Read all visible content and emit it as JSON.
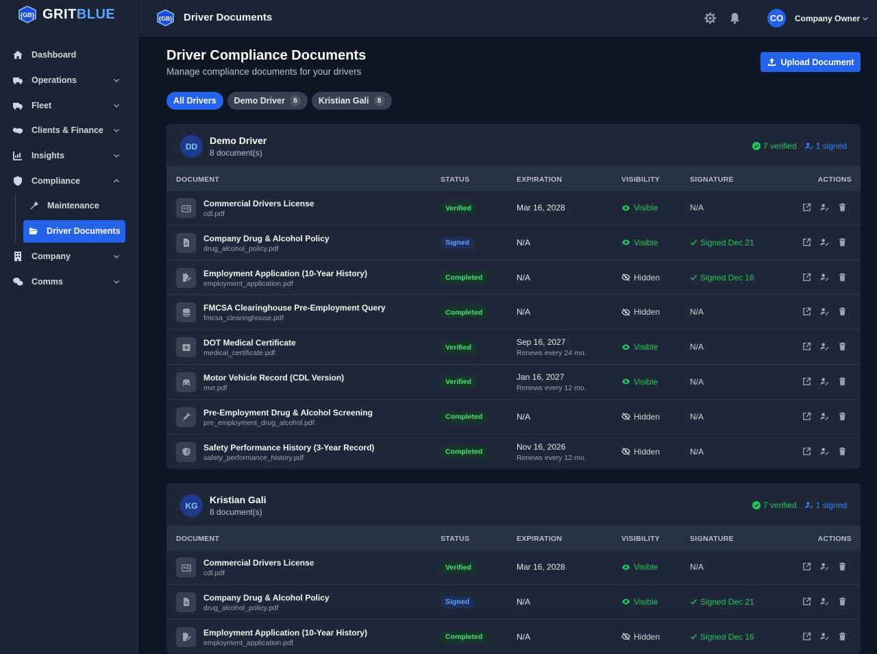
{
  "brand": {
    "name_part1": "GRIT",
    "name_part2": "BLUE",
    "badge": "{GB}"
  },
  "sidebar": {
    "items": [
      {
        "label": "Dashboard",
        "icon": "home-icon"
      },
      {
        "label": "Operations",
        "icon": "truck-icon"
      },
      {
        "label": "Fleet",
        "icon": "truck-icon"
      },
      {
        "label": "Clients & Finance",
        "icon": "handshake-icon"
      },
      {
        "label": "Insights",
        "icon": "chart-icon"
      },
      {
        "label": "Compliance",
        "icon": "shield-icon"
      }
    ],
    "compliance_sub": [
      {
        "label": "Maintenance",
        "icon": "wrench-icon"
      },
      {
        "label": "Driver Documents",
        "icon": "folder-open-icon",
        "active": true
      }
    ],
    "items_after": [
      {
        "label": "Company",
        "icon": "building-icon"
      },
      {
        "label": "Comms",
        "icon": "chat-icon"
      }
    ]
  },
  "topbar": {
    "title": "Driver Documents",
    "user_initials": "CO",
    "user_name": "Company Owner"
  },
  "page": {
    "title": "Driver Compliance Documents",
    "subtitle": "Manage compliance documents for your drivers",
    "upload_label": "Upload Document"
  },
  "filters": [
    {
      "label": "All Drivers",
      "active": true
    },
    {
      "label": "Demo Driver",
      "count": "8"
    },
    {
      "label": "Kristian Gali",
      "count": "8"
    }
  ],
  "table_headers": {
    "document": "DOCUMENT",
    "status": "STATUS",
    "expiration": "EXPIRATION",
    "visibility": "VISIBILITY",
    "signature": "SIGNATURE",
    "actions": "ACTIONS"
  },
  "drivers": [
    {
      "initials": "DD",
      "name": "Demo Driver",
      "count_text": "8 document(s)",
      "verified": "7 verified",
      "signed": "1 signed",
      "docs": [
        {
          "name": "Commercial Drivers License",
          "file": "cdl.pdf",
          "icon": "id-card-icon",
          "status": "Verified",
          "status_color": "green",
          "exp": "Mar 16, 2028",
          "exp_sub": "",
          "visibility": "Visible",
          "signature": "N/A"
        },
        {
          "name": "Company Drug & Alcohol Policy",
          "file": "drug_alcohol_policy.pdf",
          "icon": "file-icon",
          "status": "Signed",
          "status_color": "blue",
          "exp": "N/A",
          "exp_sub": "",
          "visibility": "Visible",
          "signature": "Signed Dec 21"
        },
        {
          "name": "Employment Application (10-Year History)",
          "file": "employment_application.pdf",
          "icon": "file-signature-icon",
          "status": "Completed",
          "status_color": "green",
          "exp": "N/A",
          "exp_sub": "",
          "visibility": "Hidden",
          "signature": "Signed Dec 16"
        },
        {
          "name": "FMCSA Clearinghouse Pre-Employment Query",
          "file": "fmcsa_clearinghouse.pdf",
          "icon": "database-icon",
          "status": "Completed",
          "status_color": "green",
          "exp": "N/A",
          "exp_sub": "",
          "visibility": "Hidden",
          "signature": "N/A"
        },
        {
          "name": "DOT Medical Certificate",
          "file": "medical_certificate.pdf",
          "icon": "medical-icon",
          "status": "Verified",
          "status_color": "green",
          "exp": "Sep 16, 2027",
          "exp_sub": "Renews every 24 mo.",
          "visibility": "Visible",
          "signature": "N/A"
        },
        {
          "name": "Motor Vehicle Record (CDL Version)",
          "file": "mvr.pdf",
          "icon": "car-icon",
          "status": "Verified",
          "status_color": "green",
          "exp": "Jan 16, 2027",
          "exp_sub": "Renews every 12 mo.",
          "visibility": "Visible",
          "signature": "N/A"
        },
        {
          "name": "Pre-Employment Drug & Alcohol Screening",
          "file": "pre_employment_drug_alcohol.pdf",
          "icon": "syringe-icon",
          "status": "Completed",
          "status_color": "green",
          "exp": "N/A",
          "exp_sub": "",
          "visibility": "Hidden",
          "signature": "N/A"
        },
        {
          "name": "Safety Performance History (3-Year Record)",
          "file": "safety_performance_history.pdf",
          "icon": "shield-icon",
          "status": "Completed",
          "status_color": "green",
          "exp": "Nov 16, 2026",
          "exp_sub": "Renews every 12 mo.",
          "visibility": "Hidden",
          "signature": "N/A"
        }
      ]
    },
    {
      "initials": "KG",
      "name": "Kristian Gali",
      "count_text": "8 document(s)",
      "verified": "7 verified",
      "signed": "1 signed",
      "docs": [
        {
          "name": "Commercial Drivers License",
          "file": "cdl.pdf",
          "icon": "id-card-icon",
          "status": "Verified",
          "status_color": "green",
          "exp": "Mar 16, 2028",
          "exp_sub": "",
          "visibility": "Visible",
          "signature": "N/A"
        },
        {
          "name": "Company Drug & Alcohol Policy",
          "file": "drug_alcohol_policy.pdf",
          "icon": "file-icon",
          "status": "Signed",
          "status_color": "blue",
          "exp": "N/A",
          "exp_sub": "",
          "visibility": "Visible",
          "signature": "Signed Dec 21"
        },
        {
          "name": "Employment Application (10-Year History)",
          "file": "employment_application.pdf",
          "icon": "file-signature-icon",
          "status": "Completed",
          "status_color": "green",
          "exp": "N/A",
          "exp_sub": "",
          "visibility": "Hidden",
          "signature": "Signed Dec 16"
        }
      ]
    }
  ],
  "colors": {
    "accent": "#2563eb",
    "verified": "#22c55e",
    "signed": "#3b82f6",
    "background": "#0f1726",
    "panel": "#1e2838"
  }
}
